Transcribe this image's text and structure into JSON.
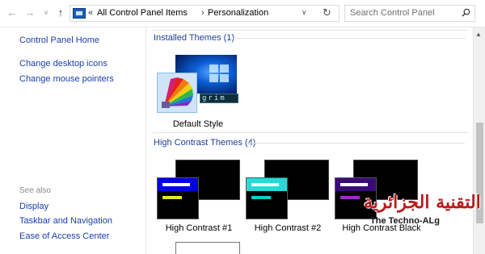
{
  "address_bar": {
    "back_icon": "arrow-left-icon",
    "forward_icon": "arrow-right-icon",
    "recent_icon": "chevron-down-icon",
    "up_icon": "arrow-up-icon",
    "location_icon": "control-panel-icon",
    "overflow": "«",
    "breadcrumbs": [
      "All Control Panel Items",
      "Personalization"
    ],
    "refresh_icon": "refresh-icon",
    "search_placeholder": "Search Control Panel"
  },
  "left_pane": {
    "links": [
      "Control Panel Home",
      "Change desktop icons",
      "Change mouse pointers"
    ],
    "see_also_header": "See also",
    "see_also_links": [
      "Display",
      "Taskbar and Navigation",
      "Ease of Access Center"
    ]
  },
  "sections": {
    "installed": {
      "title": "Installed Themes (1)",
      "themes": [
        {
          "label": "Default Style",
          "strip_text": "grim",
          "selected": true
        }
      ]
    },
    "high_contrast": {
      "title": "High Contrast Themes (4)",
      "themes": [
        {
          "label": "High Contrast #1",
          "accent_top": "#ffffff",
          "accent_bottom": "#e6e62a",
          "front_bg": "#0000e0"
        },
        {
          "label": "High Contrast #2",
          "accent_top": "#ffffff",
          "accent_bottom": "#00d0d0",
          "front_bg": "#2ad8d8"
        },
        {
          "label": "High Contrast Black",
          "accent_top": "#ffffff",
          "accent_bottom": "#9a2cc8",
          "front_bg": "#3a0a78"
        }
      ]
    }
  },
  "watermark": {
    "arabic": "التقنية الجزائرية",
    "english": "The Techno-ALg"
  },
  "colors": {
    "link": "#1a3ea8",
    "section_title": "#1e3f91"
  }
}
